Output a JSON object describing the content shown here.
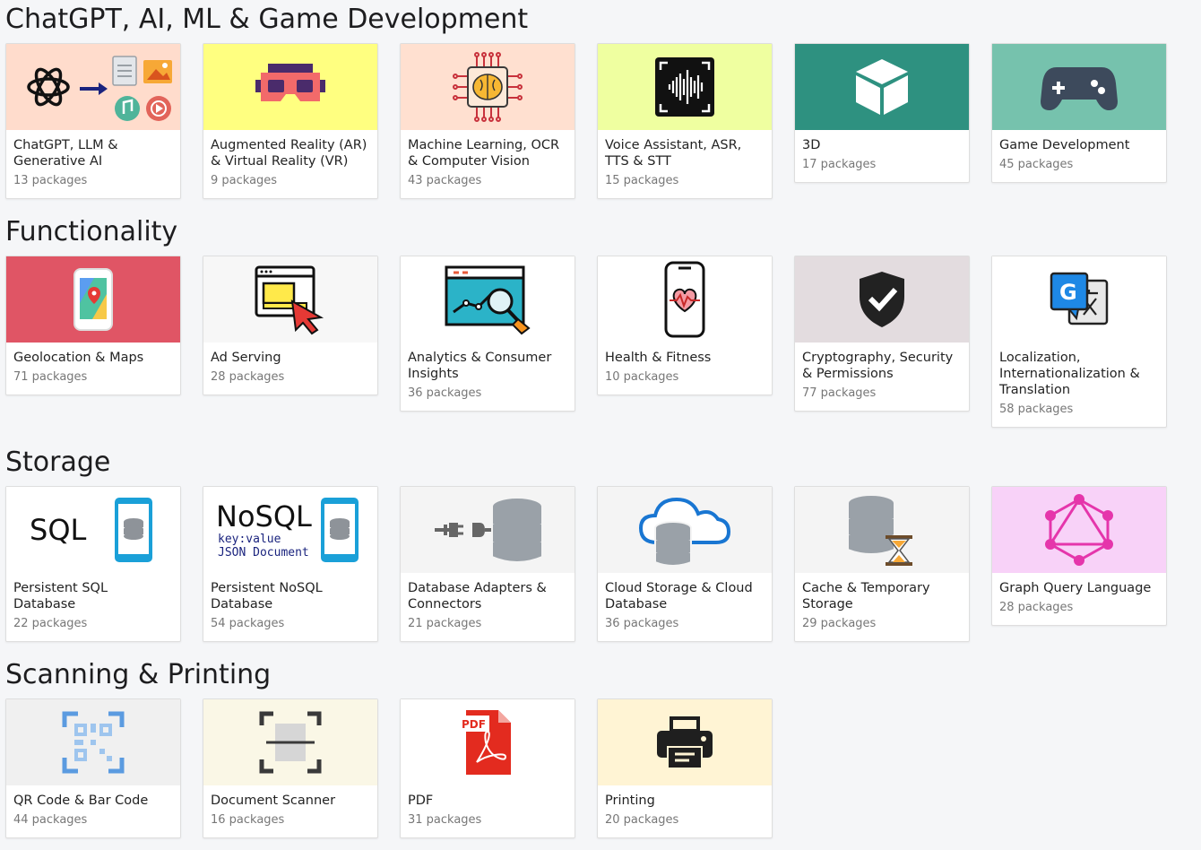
{
  "sections": [
    {
      "title": "ChatGPT, AI, ML & Game Development",
      "cards": [
        {
          "name": "ChatGPT, LLM & Generative AI",
          "count": "13 packages",
          "icon": "ai-generative-icon",
          "bg": "#ffdccc"
        },
        {
          "name": "Augmented Reality (AR) & Virtual Reality (VR)",
          "count": "9 packages",
          "icon": "vr-headset-icon",
          "bg": "#ffff80"
        },
        {
          "name": "Machine Learning, OCR & Computer Vision",
          "count": "43 packages",
          "icon": "brain-chip-icon",
          "bg": "#ffe0d0"
        },
        {
          "name": "Voice Assistant, ASR, TTS & STT",
          "count": "15 packages",
          "icon": "voice-waveform-icon",
          "bg": "#efffa0"
        },
        {
          "name": "3D",
          "count": "17 packages",
          "icon": "cube-icon",
          "bg": "#2e9180"
        },
        {
          "name": "Game Development",
          "count": "45 packages",
          "icon": "gamepad-icon",
          "bg": "#76c2ad"
        }
      ]
    },
    {
      "title": "Functionality",
      "cards": [
        {
          "name": "Geolocation & Maps",
          "count": "71 packages",
          "icon": "map-phone-icon",
          "bg": "#e05565"
        },
        {
          "name": "Ad Serving",
          "count": "28 packages",
          "icon": "ad-click-icon",
          "bg": "#f7f7f7"
        },
        {
          "name": "Analytics & Consumer Insights",
          "count": "36 packages",
          "icon": "analytics-icon",
          "bg": "#ffffff"
        },
        {
          "name": "Health & Fitness",
          "count": "10 packages",
          "icon": "health-phone-icon",
          "bg": "#ffffff"
        },
        {
          "name": "Cryptography, Security & Permissions",
          "count": "77 packages",
          "icon": "shield-check-icon",
          "bg": "#e3dcdf"
        },
        {
          "name": "Localization, Internationalization & Translation",
          "count": "58 packages",
          "icon": "translate-icon",
          "bg": "#ffffff"
        }
      ]
    },
    {
      "title": "Storage",
      "cards": [
        {
          "name": "Persistent SQL Database",
          "count": "22 packages",
          "icon": "sql-database-icon",
          "bg": "#ffffff",
          "label": "SQL"
        },
        {
          "name": "Persistent NoSQL Database",
          "count": "54 packages",
          "icon": "nosql-database-icon",
          "bg": "#ffffff",
          "label": "NoSQL",
          "sub1": "key:value",
          "sub2": "JSON Document"
        },
        {
          "name": "Database Adapters & Connectors",
          "count": "21 packages",
          "icon": "database-plug-icon",
          "bg": "#f4f4f4"
        },
        {
          "name": "Cloud Storage & Cloud Database",
          "count": "36 packages",
          "icon": "cloud-database-icon",
          "bg": "#f4f4f4"
        },
        {
          "name": "Cache & Temporary Storage",
          "count": "29 packages",
          "icon": "database-hourglass-icon",
          "bg": "#f4f4f4"
        },
        {
          "name": "Graph Query Language",
          "count": "28 packages",
          "icon": "graphql-icon",
          "bg": "#f8d2f8"
        }
      ]
    },
    {
      "title": "Scanning & Printing",
      "cards": [
        {
          "name": "QR Code & Bar Code",
          "count": "44 packages",
          "icon": "qr-scan-icon",
          "bg": "#f0f0f0"
        },
        {
          "name": "Document Scanner",
          "count": "16 packages",
          "icon": "document-scan-icon",
          "bg": "#faf7e6"
        },
        {
          "name": "PDF",
          "count": "31 packages",
          "icon": "pdf-file-icon",
          "bg": "#ffffff",
          "label": "PDF"
        },
        {
          "name": "Printing",
          "count": "20 packages",
          "icon": "printer-icon",
          "bg": "#fff4d4"
        }
      ]
    }
  ]
}
